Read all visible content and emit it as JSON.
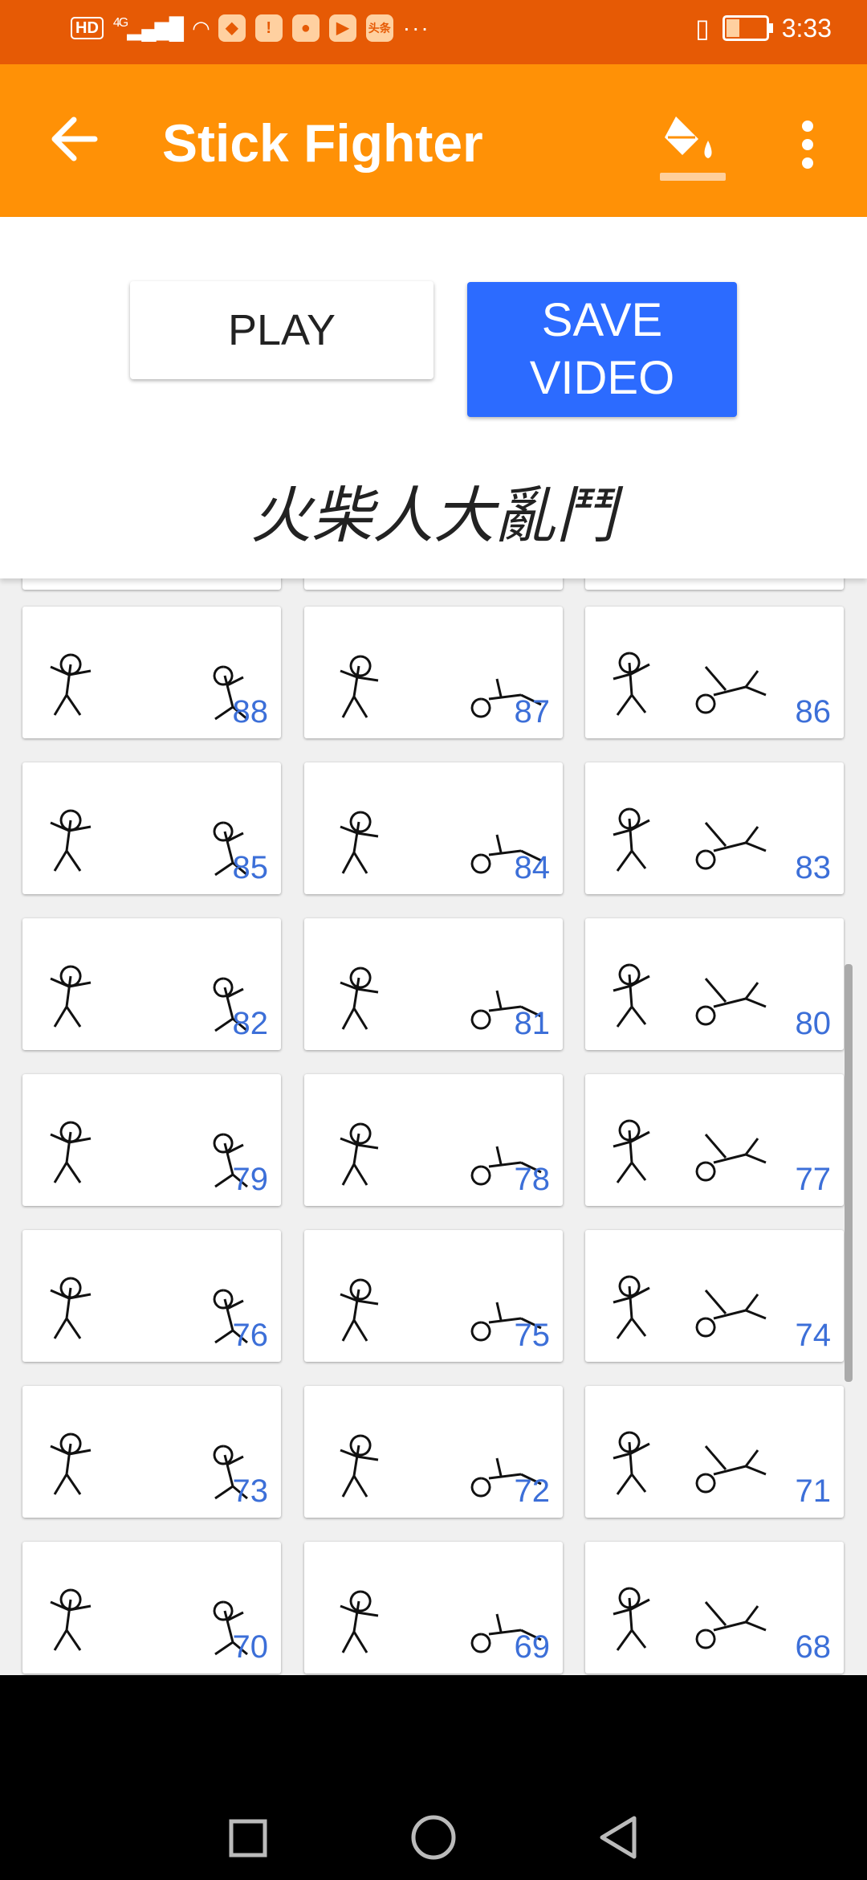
{
  "status_bar": {
    "left_badges": [
      "HD",
      "4G"
    ],
    "app_icon_texts": [
      "头条"
    ],
    "more": "···",
    "time": "3:33"
  },
  "app_bar": {
    "title": "Stick Fighter",
    "color": "#ff9106"
  },
  "controls": {
    "play_label": "PLAY",
    "save_label": "SAVE VIDEO",
    "save_color": "#2c6bff"
  },
  "movie_title": "火柴人大亂鬥",
  "frames": [
    {
      "num": "88"
    },
    {
      "num": "87"
    },
    {
      "num": "86"
    },
    {
      "num": "85"
    },
    {
      "num": "84"
    },
    {
      "num": "83"
    },
    {
      "num": "82"
    },
    {
      "num": "81"
    },
    {
      "num": "80"
    },
    {
      "num": "79"
    },
    {
      "num": "78"
    },
    {
      "num": "77"
    },
    {
      "num": "76"
    },
    {
      "num": "75"
    },
    {
      "num": "74"
    },
    {
      "num": "73"
    },
    {
      "num": "72"
    },
    {
      "num": "71"
    },
    {
      "num": "70"
    },
    {
      "num": "69"
    },
    {
      "num": "68"
    }
  ],
  "nav": {
    "icons": [
      "recents-square-icon",
      "home-circle-icon",
      "back-triangle-icon"
    ]
  }
}
